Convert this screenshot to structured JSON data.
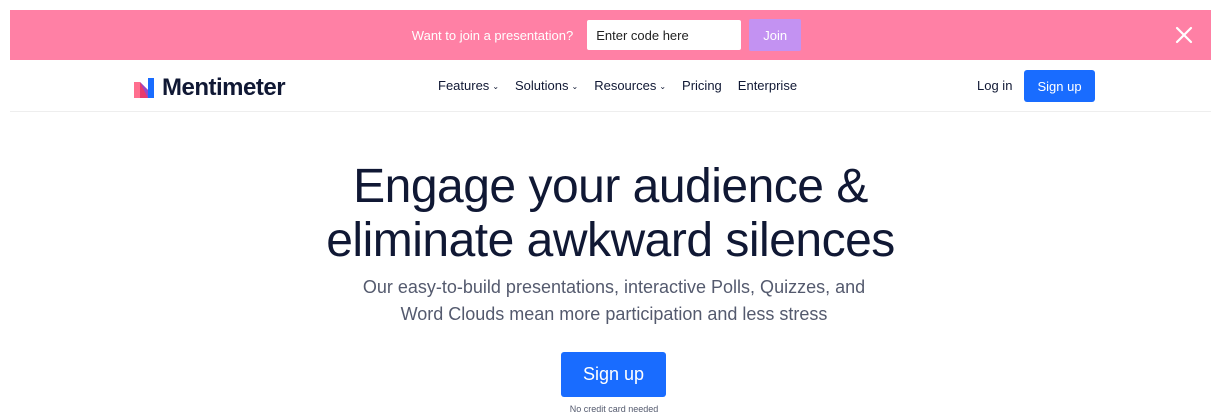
{
  "banner": {
    "text": "Want to join a presentation?",
    "code_placeholder": "Enter code here",
    "join_label": "Join"
  },
  "nav": {
    "logo_text": "Mentimeter",
    "menu": [
      {
        "label": "Features",
        "has_dropdown": true
      },
      {
        "label": "Solutions",
        "has_dropdown": true
      },
      {
        "label": "Resources",
        "has_dropdown": true
      },
      {
        "label": "Pricing",
        "has_dropdown": false
      },
      {
        "label": "Enterprise",
        "has_dropdown": false
      }
    ],
    "login_label": "Log in",
    "signup_label": "Sign up"
  },
  "hero": {
    "title_line1": "Engage your audience &",
    "title_line2": "eliminate awkward silences",
    "subtitle_line1": "Our easy-to-build presentations, interactive Polls, Quizzes, and",
    "subtitle_line2": "Word Clouds mean more participation and less stress",
    "cta_label": "Sign up",
    "cta_note": "No credit card needed"
  },
  "icons": {
    "close": "close-icon",
    "chevron": "chevron-down-icon",
    "logo": "mentimeter-logo-icon"
  },
  "colors": {
    "banner_bg": "#ff80a5",
    "join_bg": "#c392f2",
    "primary": "#196cff",
    "text_dark": "#101834",
    "text_muted": "#545a6e"
  }
}
